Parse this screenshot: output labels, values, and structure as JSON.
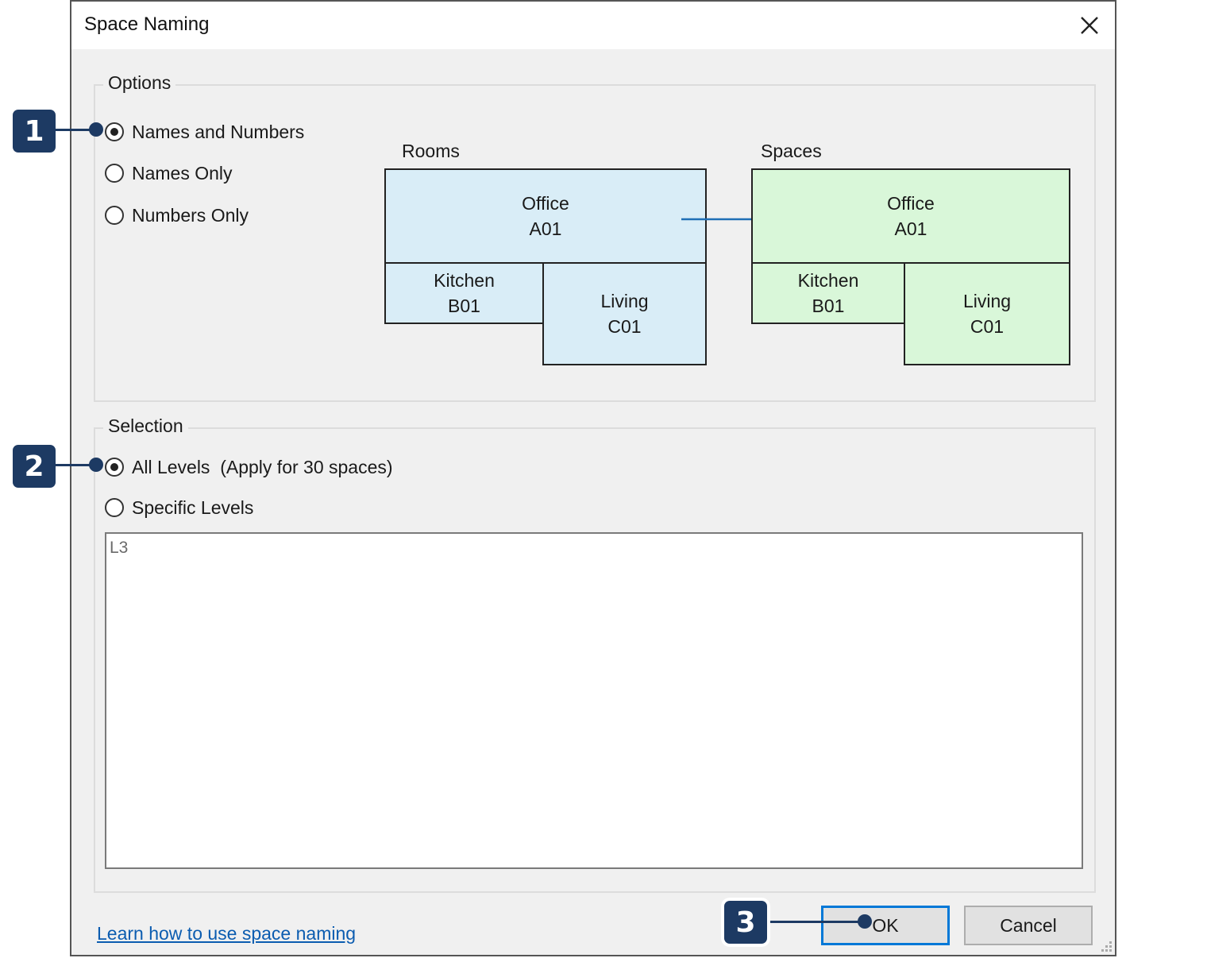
{
  "dialog": {
    "title": "Space Naming",
    "close_icon": "close-icon"
  },
  "options": {
    "label": "Options",
    "radios": [
      {
        "label": "Names and Numbers",
        "checked": true
      },
      {
        "label": "Names Only",
        "checked": false
      },
      {
        "label": "Numbers Only",
        "checked": false
      }
    ]
  },
  "diagram": {
    "rooms_title": "Rooms",
    "spaces_title": "Spaces",
    "rooms": [
      {
        "name": "Office",
        "number": "A01"
      },
      {
        "name": "Kitchen",
        "number": "B01"
      },
      {
        "name": "Living",
        "number": "C01"
      }
    ],
    "spaces": [
      {
        "name": "Office",
        "number": "A01"
      },
      {
        "name": "Kitchen",
        "number": "B01"
      },
      {
        "name": "Living",
        "number": "C01"
      }
    ],
    "arrow_color": "#1f6fb5",
    "rooms_color": "#d9edf7",
    "spaces_color": "#d9f7d9"
  },
  "selection": {
    "label": "Selection",
    "radios": [
      {
        "label": "All Levels  (Apply for 30 spaces)",
        "checked": true
      },
      {
        "label": "Specific Levels",
        "checked": false
      }
    ],
    "levels_list": [
      "L3"
    ]
  },
  "footer": {
    "help_link": "Learn how to use space naming",
    "ok_label": "OK",
    "cancel_label": "Cancel"
  },
  "callouts": [
    {
      "number": "1"
    },
    {
      "number": "2"
    },
    {
      "number": "3"
    }
  ],
  "colors": {
    "callout": "#1d3a63",
    "default_button_border": "#0078d7",
    "link": "#0b5cb0"
  }
}
